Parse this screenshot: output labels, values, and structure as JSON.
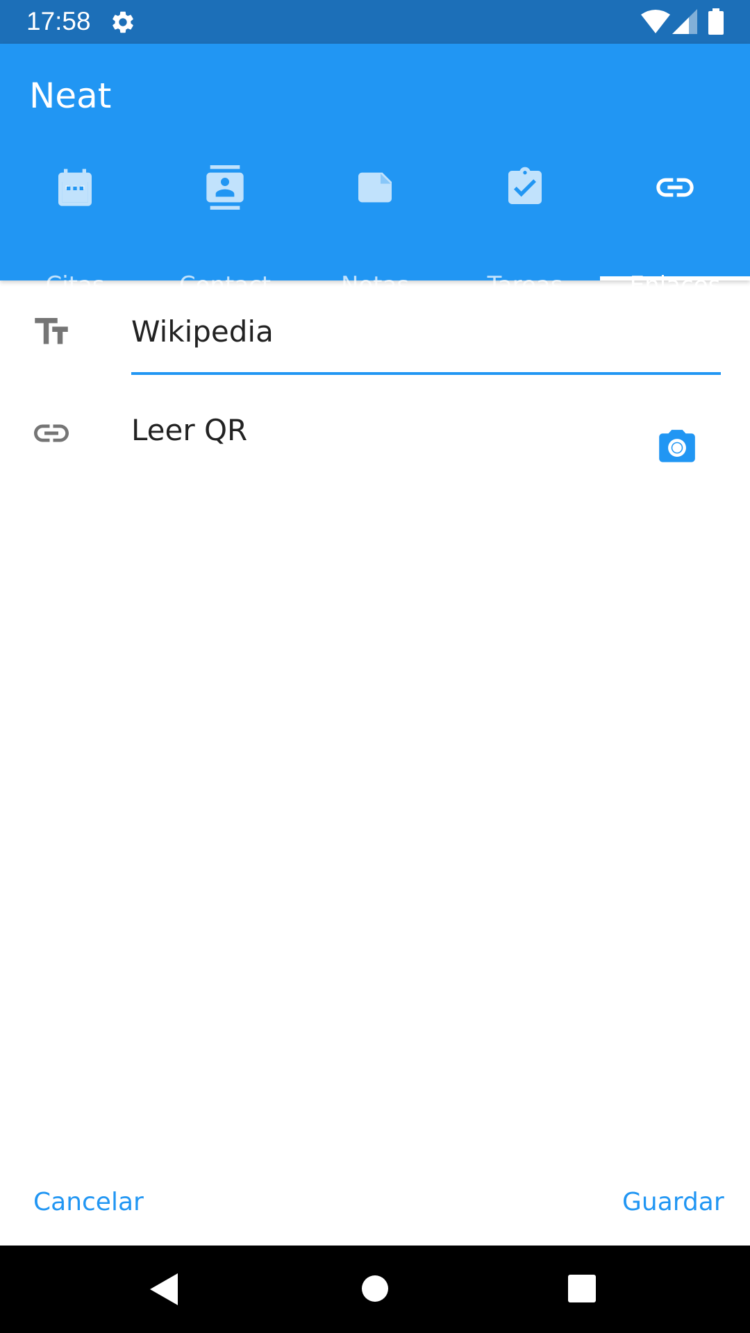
{
  "status_bar": {
    "time": "17:58",
    "icons": [
      "gear-icon",
      "wifi-icon",
      "signal-icon",
      "battery-icon"
    ]
  },
  "app": {
    "title": "Neat"
  },
  "tabs": [
    {
      "label": "Citas",
      "icon": "calendar-icon",
      "active": false
    },
    {
      "label": "Contact",
      "icon": "contact-card-icon",
      "active": false
    },
    {
      "label": "Notas",
      "icon": "note-icon",
      "active": false
    },
    {
      "label": "Tareas",
      "icon": "clipboard-check-icon",
      "active": false
    },
    {
      "label": "Enlaces",
      "icon": "link-icon",
      "active": true
    }
  ],
  "form": {
    "title_value": "Wikipedia",
    "title_icon": "text-format-icon",
    "link_icon": "link-icon",
    "link_text": "Leer QR",
    "camera_icon": "camera-icon"
  },
  "actions": {
    "cancel": "Cancelar",
    "save": "Guardar"
  },
  "nav": {
    "icons": [
      "back-icon",
      "home-icon",
      "recents-icon"
    ]
  },
  "colors": {
    "status_bar": "#1c6fb8",
    "app_bar": "#2196f3",
    "accent": "#2196f3",
    "icon_gray": "#757575",
    "text": "#222222"
  }
}
